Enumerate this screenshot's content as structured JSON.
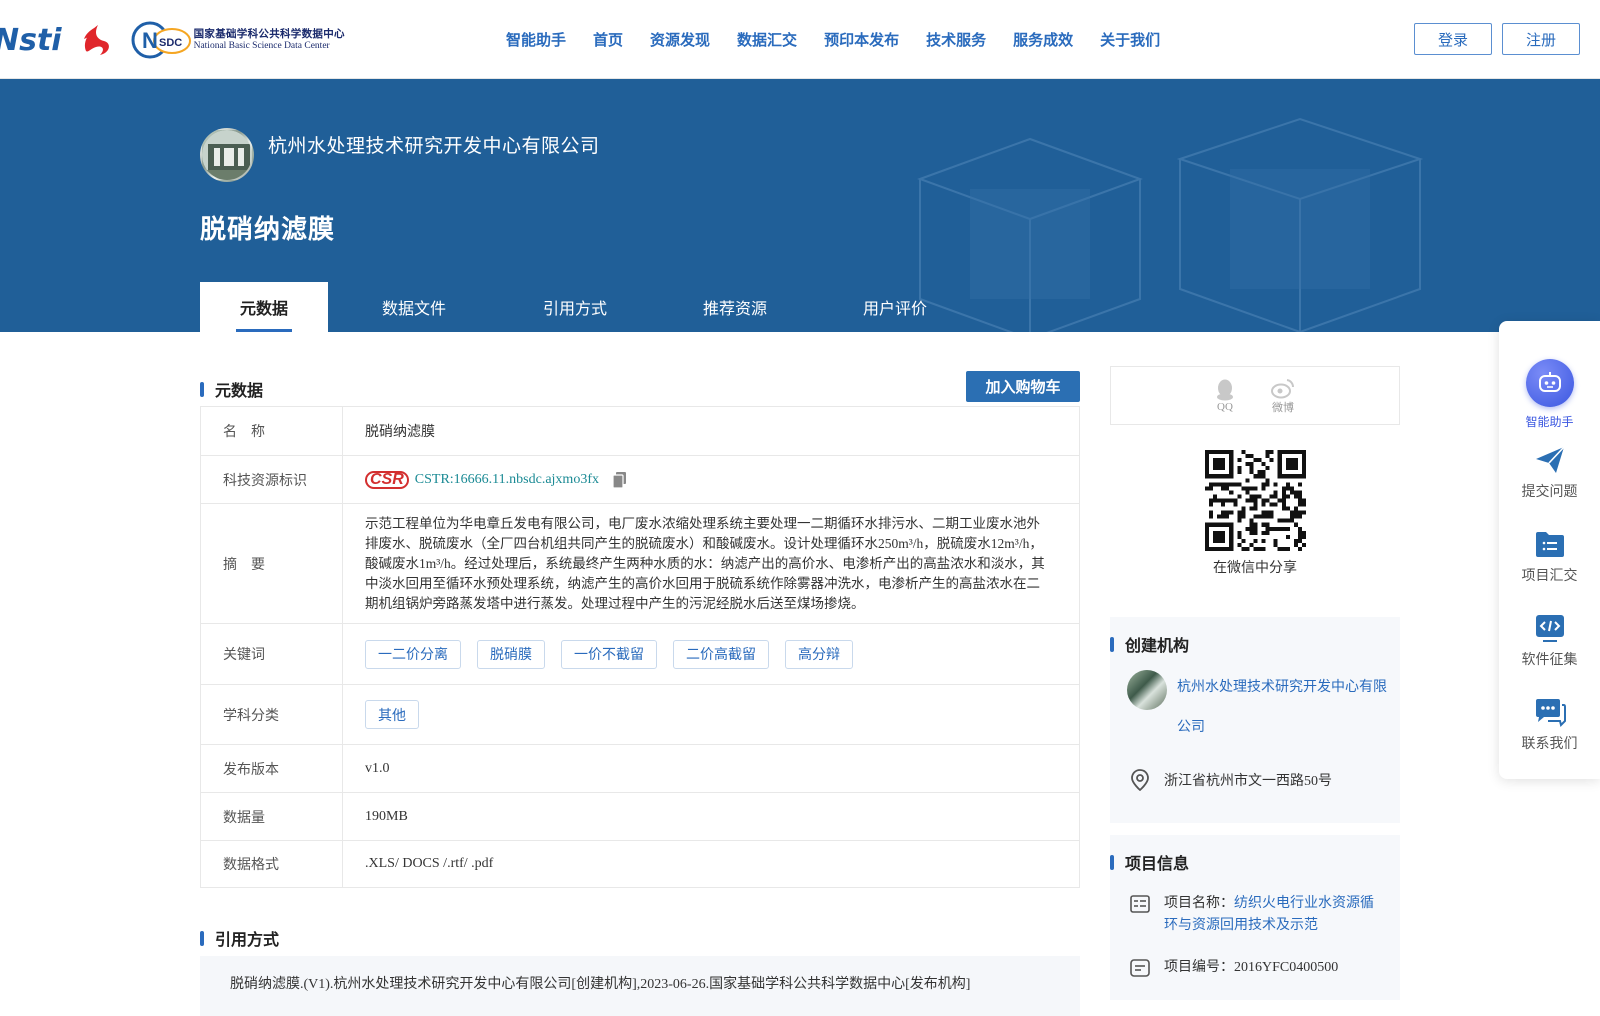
{
  "header": {
    "logo_nsti": "Nsti",
    "logo_nsdc_mark": "NSDC",
    "logo_nsdc_cn": "国家基础学科公共科学数据中心",
    "logo_nsdc_en": "National Basic Science Data Center",
    "nav": [
      "智能助手",
      "首页",
      "资源发现",
      "数据汇交",
      "预印本发布",
      "技术服务",
      "服务成效",
      "关于我们"
    ],
    "login": "登录",
    "register": "注册"
  },
  "banner": {
    "org_name": "杭州水处理技术研究开发中心有限公司",
    "title": "脱硝纳滤膜",
    "tabs": [
      "元数据",
      "数据文件",
      "引用方式",
      "推荐资源",
      "用户评价"
    ]
  },
  "metadata": {
    "heading": "元数据",
    "cart_button": "加入购物车",
    "labels": {
      "name": "名    称",
      "cstr": "科技资源标识",
      "abstract": "摘    要",
      "keywords": "关键词",
      "subject": "学科分类",
      "version": "发布版本",
      "size": "数据量",
      "format": "数据格式"
    },
    "name": "脱硝纳滤膜",
    "cstr_logo": "CSR",
    "cstr": "CSTR:16666.11.nbsdc.ajxmo3fx",
    "abstract": "示范工程单位为华电章丘发电有限公司，电厂废水浓缩处理系统主要处理一二期循环水排污水、二期工业废水池外排废水、脱硫废水（全厂四台机组共同产生的脱硫废水）和酸碱废水。设计处理循环水250m³/h，脱硫废水12m³/h，酸碱废水1m³/h。经过处理后，系统最终产生两种水质的水：纳滤产出的高价水、电渗析产出的高盐浓水和淡水，其中淡水回用至循环水预处理系统，纳滤产生的高价水回用于脱硫系统作除雾器冲洗水，电渗析产生的高盐浓水在二期机组锅炉旁路蒸发塔中进行蒸发。处理过程中产生的污泥经脱水后送至煤场掺烧。",
    "keywords": [
      "一二价分离",
      "脱硝膜",
      "一价不截留",
      "二价高截留",
      "高分辩"
    ],
    "subject": "其他",
    "version": "v1.0",
    "size": "190MB",
    "format": ".XLS/ DOCS /.rtf/ .pdf"
  },
  "citation": {
    "heading": "引用方式",
    "text": "脱硝纳滤膜.(V1).杭州水处理技术研究开发中心有限公司[创建机构],2023-06-26.国家基础学科公共科学数据中心[发布机构]"
  },
  "share": {
    "qq": "QQ",
    "weibo": "微博",
    "wechat_caption": "在微信中分享"
  },
  "creator": {
    "heading": "创建机构",
    "org": "杭州水处理技术研究开发中心有限公司",
    "address": "浙江省杭州市文一西路50号"
  },
  "project": {
    "heading": "项目信息",
    "name_label": "项目名称：",
    "name": "纺织火电行业水资源循环与资源回用技术及示范",
    "code_label": "项目编号：",
    "code": "2016YFC0400500"
  },
  "float_bar": [
    "智能助手",
    "提交问题",
    "项目汇交",
    "软件征集",
    "联系我们"
  ],
  "colors": {
    "brand_blue": "#2a6bbd",
    "banner_blue": "#205f98",
    "cstr_teal": "#1a8a94"
  }
}
